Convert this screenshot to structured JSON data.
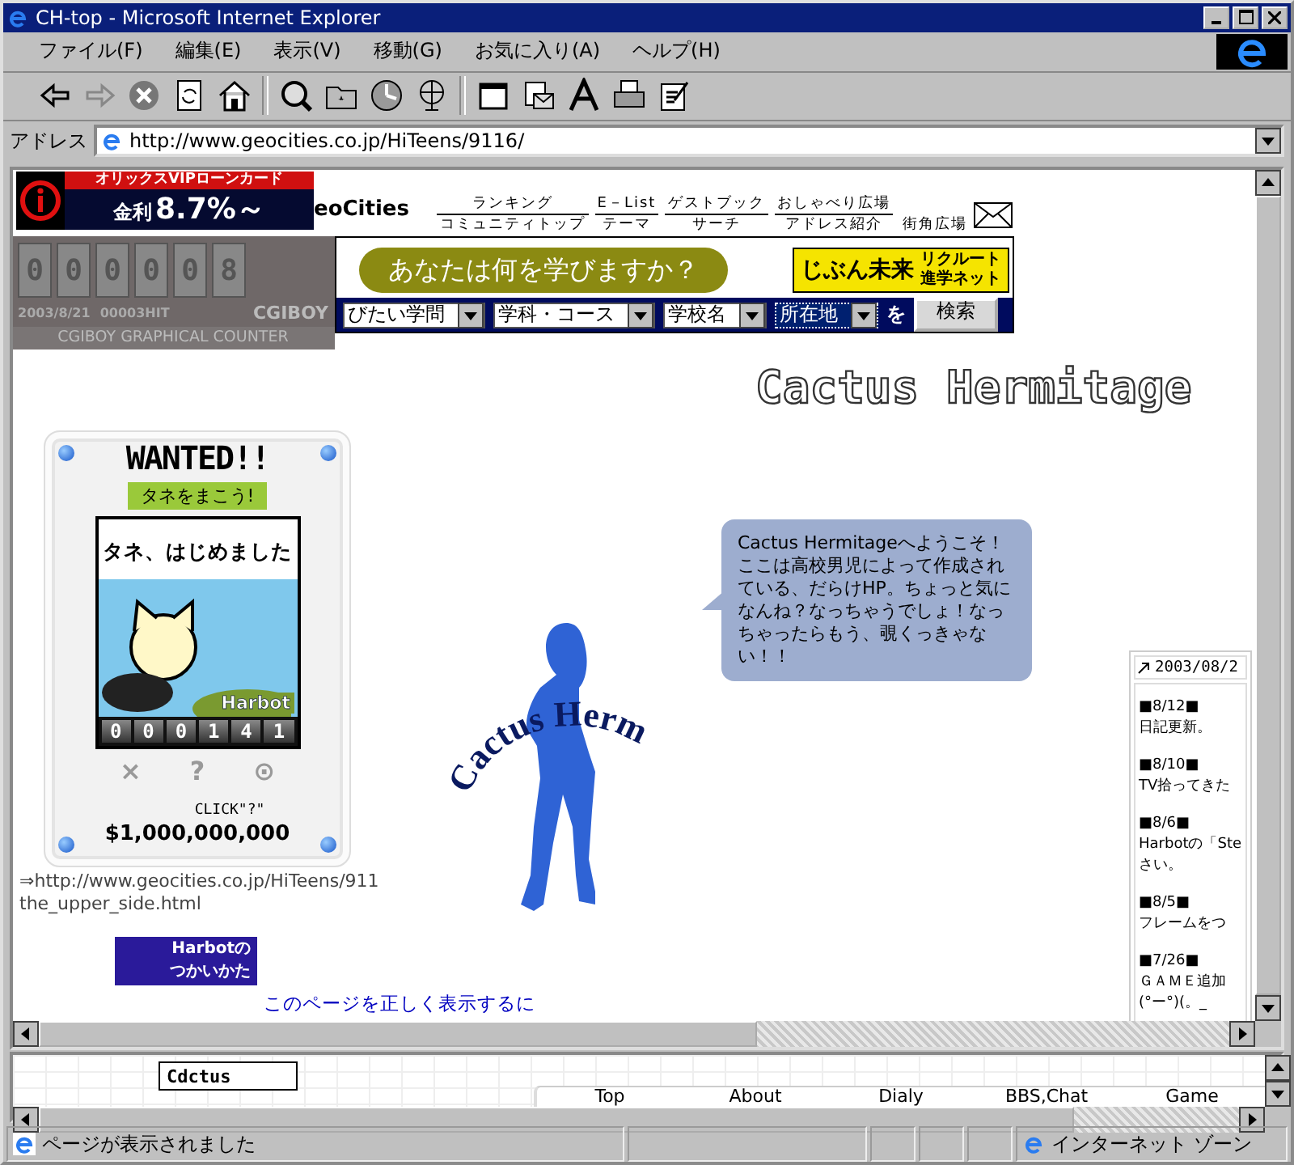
{
  "window": {
    "title": "CH-top - Microsoft Internet Explorer"
  },
  "menu": [
    "ファイル(F)",
    "編集(E)",
    "表示(V)",
    "移動(G)",
    "お気に入り(A)",
    "ヘルプ(H)"
  ],
  "address": {
    "label": "アドレス",
    "url": "http://www.geocities.co.jp/HiTeens/9116/"
  },
  "banner_ad": {
    "heading": "オリックスVIPローンカード",
    "rate_label": "金利",
    "rate": "8.7%～"
  },
  "geocities": {
    "logo": "eoCities",
    "nav_top": [
      "ランキング",
      "E－List",
      "ゲストブック",
      "おしゃべり広場"
    ],
    "nav_bottom": [
      "コミュニティトップ",
      "テーマ",
      "サーチ",
      "アドレス紹介",
      "街角広場"
    ]
  },
  "counter": {
    "digits": [
      "0",
      "0",
      "0",
      "0",
      "0",
      "8"
    ],
    "date": "2003/8/21",
    "hits": "00003HIT",
    "brand": "CGIBOY",
    "caption": "CGIBOY GRAPHICAL COUNTER"
  },
  "school_search": {
    "question": "あなたは何を学びますか？",
    "logo_left": "じぶん未来",
    "logo_right": [
      "リクルート",
      "進学ネット"
    ],
    "dropdowns": [
      {
        "value": "びたい学問",
        "focused": false
      },
      {
        "value": "学科・コース",
        "focused": false
      },
      {
        "value": "学校名",
        "focused": false
      },
      {
        "value": "所在地",
        "focused": true
      }
    ],
    "particle": "を",
    "button": "検索"
  },
  "site_title": "Cactus Hermitage",
  "wanted": {
    "title": "WANTED!!",
    "seed_button": "タネをまこう!",
    "message": "タネ、はじめました",
    "logo": "Harbot",
    "digits": [
      "0",
      "0",
      "0",
      "1",
      "4",
      "1"
    ],
    "controls": [
      "×",
      "?",
      "⊙"
    ],
    "hint": "CLICK\"?\"",
    "reward": "$1,000,000,000"
  },
  "link_lines": [
    "⇒http://www.geocities.co.jp/HiTeens/911",
    "the_upper_side.html"
  ],
  "harbot_guide": {
    "logo": "Harbotの",
    "text": "つかいかた"
  },
  "flash_note": "このページを正しく表示するに",
  "emblem": {
    "curved_text": "Cactus Herm"
  },
  "speech_bubble": "Cactus Hermitageへようこそ！ここは高校男児によって作成されている、だらけHP。ちょっと気になんね？なっちゃうでしょ！なっちゃったらもう、覗くっきゃない！！",
  "news": {
    "date": "2003/08/2",
    "items": [
      {
        "date": "■8/12■",
        "lines": [
          "日記更新。"
        ]
      },
      {
        "date": "■8/10■",
        "lines": [
          "TV拾ってきた"
        ]
      },
      {
        "date": "■8/6■",
        "lines": [
          "Harbotの「Ste",
          "さい。"
        ]
      },
      {
        "date": "■8/5■",
        "lines": [
          "フレームをつ"
        ]
      },
      {
        "date": "■7/26■",
        "lines": [
          "ＧＡＭＥ追加",
          "(°ー°)(。_"
        ]
      }
    ]
  },
  "bottom_frame": {
    "logo": "Cdctus",
    "tabs": [
      "Top",
      "About",
      "Dialy",
      "BBS,Chat",
      "Game"
    ]
  },
  "status_bar": {
    "text": "ページが表示されました",
    "zone": "インターネット ゾーン"
  }
}
